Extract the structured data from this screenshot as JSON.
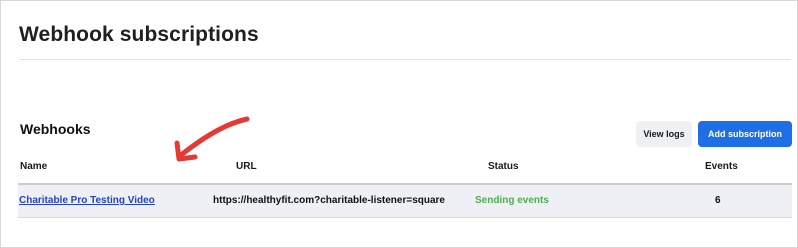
{
  "page": {
    "title": "Webhook subscriptions"
  },
  "webhooks": {
    "section_title": "Webhooks",
    "buttons": {
      "view_logs": "View logs",
      "add_subscription": "Add subscription"
    },
    "columns": [
      "Name",
      "URL",
      "Status",
      "Events"
    ],
    "rows": [
      {
        "name": "Charitable Pro Testing Video",
        "url": "https://healthyfit.com?charitable-listener=square",
        "status": "Sending events",
        "events": "6"
      }
    ]
  },
  "colors": {
    "accent_blue": "#1e6fe6",
    "link_blue": "#2343c9",
    "status_green": "#4caf50",
    "annotation_red": "#e53935"
  },
  "annotation": {
    "icon": "red-arrow-icon"
  }
}
